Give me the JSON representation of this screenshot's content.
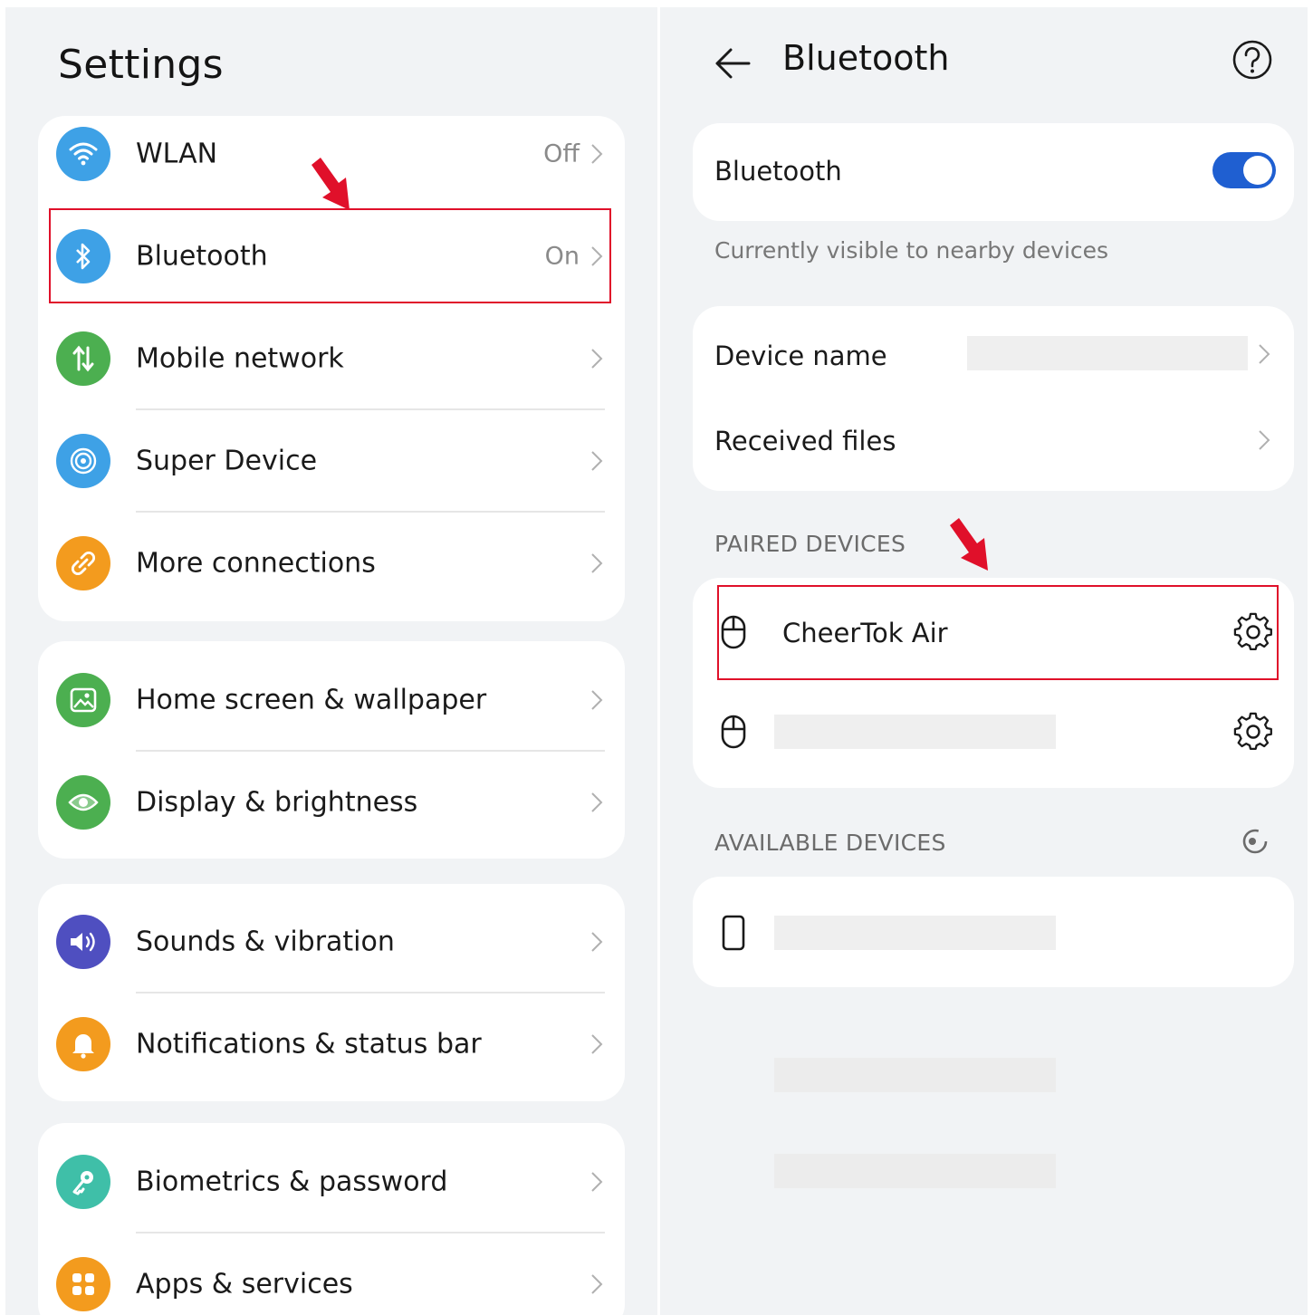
{
  "settings": {
    "title": "Settings",
    "groups": [
      {
        "items": [
          {
            "label": "WLAN",
            "value": "Off",
            "icon": "wlan-icon",
            "color": "#3ea1e6"
          },
          {
            "label": "Bluetooth",
            "value": "On",
            "icon": "bluetooth-icon",
            "color": "#3ea1e6"
          },
          {
            "label": "Mobile network",
            "value": "",
            "icon": "mobile-network-icon",
            "color": "#4caf50"
          },
          {
            "label": "Super Device",
            "value": "",
            "icon": "super-device-icon",
            "color": "#3ea1e6"
          },
          {
            "label": "More connections",
            "value": "",
            "icon": "more-connections-icon",
            "color": "#f39b1e"
          }
        ]
      },
      {
        "items": [
          {
            "label": "Home screen & wallpaper",
            "value": "",
            "icon": "wallpaper-icon",
            "color": "#4caf50"
          },
          {
            "label": "Display & brightness",
            "value": "",
            "icon": "eye-icon",
            "color": "#4caf50"
          }
        ]
      },
      {
        "items": [
          {
            "label": "Sounds & vibration",
            "value": "",
            "icon": "speaker-icon",
            "color": "#4f4fc0"
          },
          {
            "label": "Notifications & status bar",
            "value": "",
            "icon": "bell-icon",
            "color": "#f39b1e"
          }
        ]
      },
      {
        "items": [
          {
            "label": "Biometrics & password",
            "value": "",
            "icon": "key-icon",
            "color": "#3fbfa8"
          },
          {
            "label": "Apps & services",
            "value": "",
            "icon": "apps-icon",
            "color": "#f39b1e"
          }
        ]
      }
    ]
  },
  "bluetooth": {
    "title": "Bluetooth",
    "toggle_label": "Bluetooth",
    "toggle_on": true,
    "visibility_text": "Currently visible to nearby devices",
    "device_name_label": "Device name",
    "received_files_label": "Received files",
    "paired_header": "PAIRED DEVICES",
    "paired": [
      {
        "name": "CheerTok Air",
        "icon": "mouse-icon"
      },
      {
        "name": "",
        "icon": "mouse-icon"
      }
    ],
    "available_header": "AVAILABLE DEVICES",
    "available": [
      {
        "name": "",
        "icon": "phone-icon"
      }
    ]
  },
  "colors": {
    "accent": "#1f5fd1",
    "highlight": "#e0102a",
    "background": "#f1f3f5"
  }
}
